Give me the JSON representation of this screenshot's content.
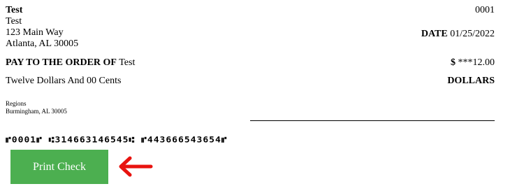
{
  "check": {
    "payer": {
      "name": "Test",
      "line1": "Test",
      "line2": "123 Main Way",
      "line3": "Atlanta, AL 30005"
    },
    "check_number": "0001",
    "date_label": "DATE",
    "date_value": "01/25/2022",
    "pay_label": "PAY TO THE ORDER OF",
    "payee": "Test",
    "amount_symbol": "$",
    "amount_value": "***12.00",
    "written_amount": "Twelve Dollars And 00 Cents",
    "dollars_label": "DOLLARS",
    "bank": {
      "name": "Regions",
      "address": "Burmingham, AL 30005"
    },
    "micr_line": "⑈0001⑈ ⑆314663146545⑆ ⑈443666543654⑈"
  },
  "actions": {
    "print_label": "Print Check"
  },
  "icons": {
    "arrow": "arrow-left-icon",
    "arrow_color": "#e8130f"
  },
  "colors": {
    "button_bg": "#4caf50",
    "button_text": "#ffffff"
  }
}
